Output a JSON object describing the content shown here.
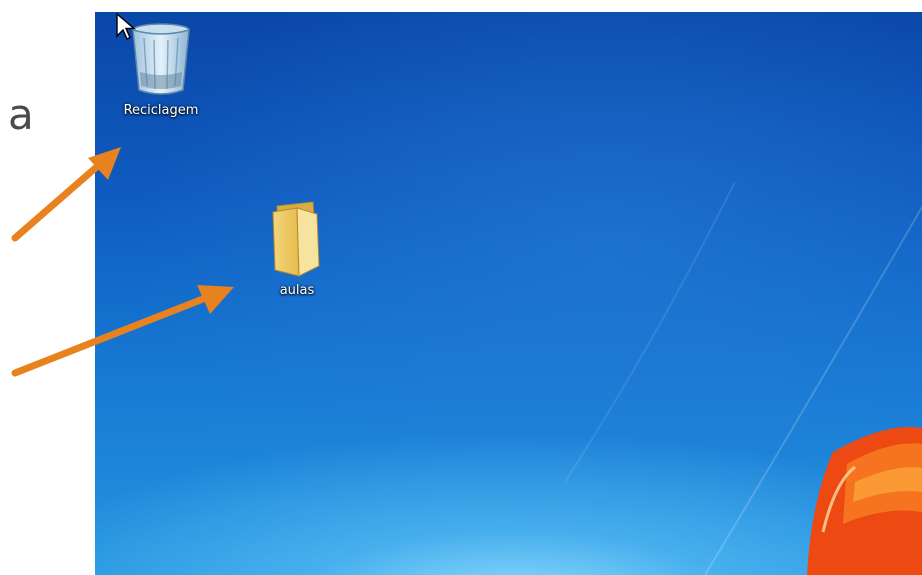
{
  "slide": {
    "partial_text": "a"
  },
  "desktop": {
    "icons": [
      {
        "label": "Reciclagem",
        "icon": "recycle-bin-icon"
      },
      {
        "label": "aulas",
        "icon": "folder-icon"
      }
    ]
  },
  "colors": {
    "arrow": "#e8821e",
    "desktop_top": "#0a47a8",
    "desktop_bottom": "#2596e0"
  }
}
